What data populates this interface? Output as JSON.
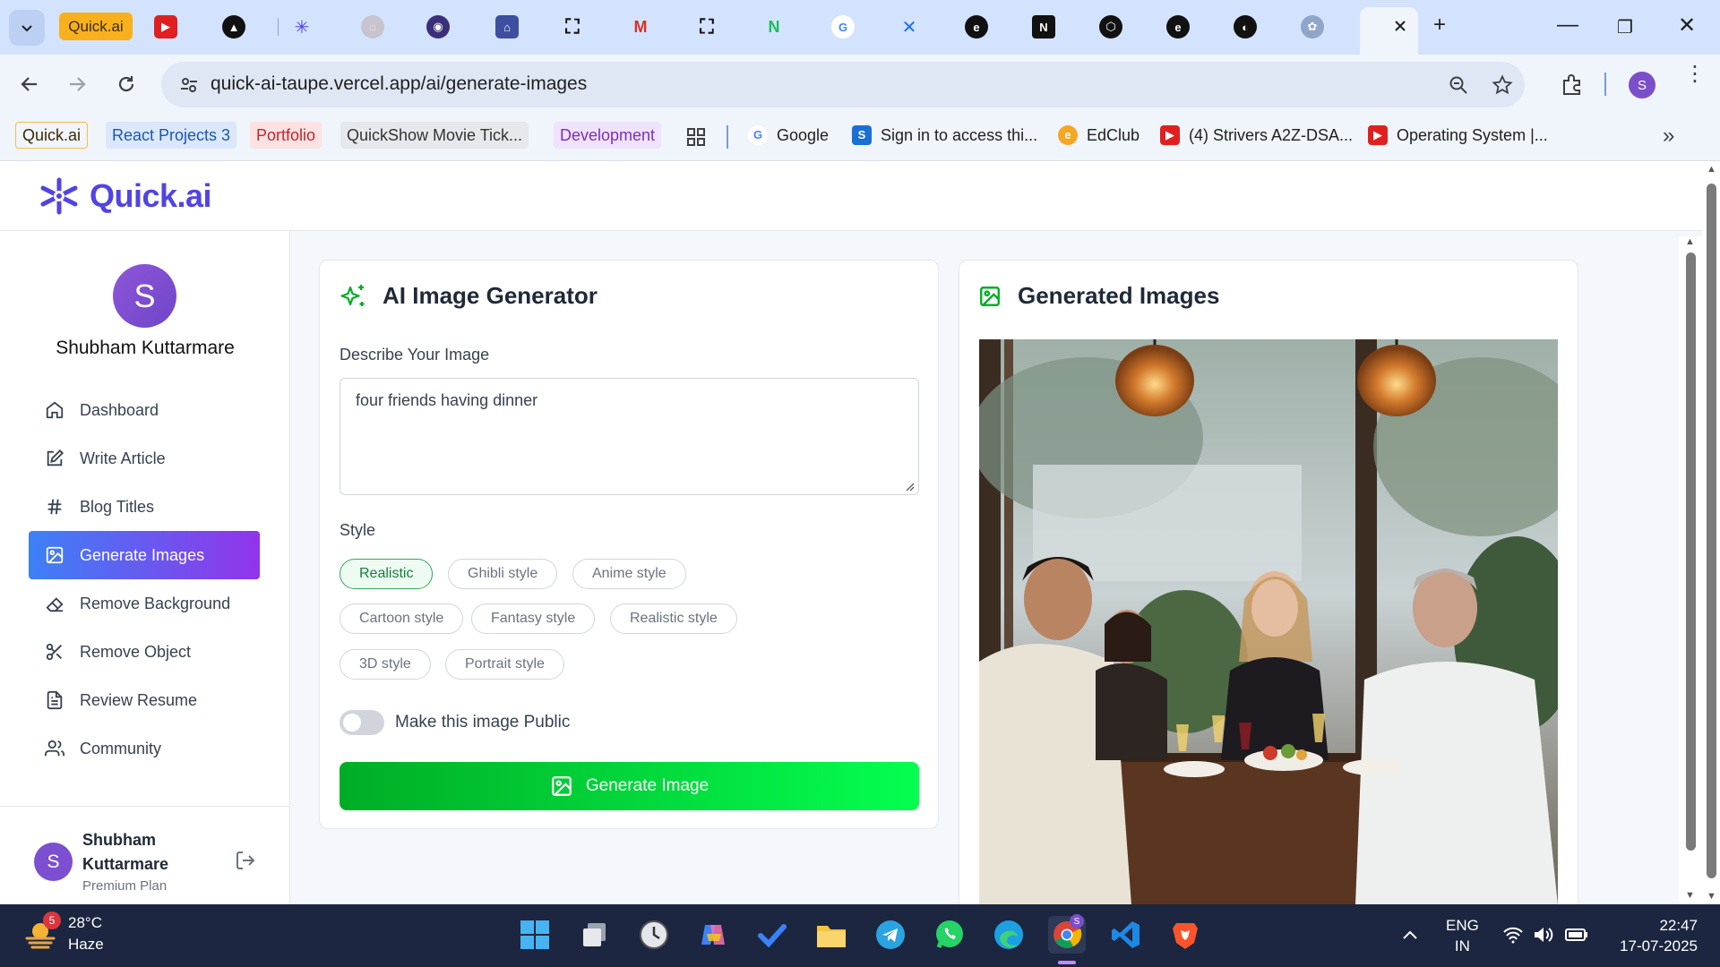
{
  "browser": {
    "first_tab_label": "Quick.ai",
    "url": "quick-ai-taupe.vercel.app/ai/generate-images"
  },
  "bookmarks": [
    {
      "label": "Quick.ai",
      "bg": "#fdf0c4",
      "color": "#3a2b00"
    },
    {
      "label": "React Projects 3",
      "bg": "#dbe8fb",
      "color": "#1a56b8"
    },
    {
      "label": "Portfolio",
      "bg": "#fde2e2",
      "color": "#c0262d"
    },
    {
      "label": "QuickShow Movie Tick...",
      "bg": "#e6e8ec",
      "color": "#333333"
    },
    {
      "label": "Development",
      "bg": "#efe3fb",
      "color": "#7b2fbe"
    }
  ],
  "bookmark_links": [
    {
      "label": "Google",
      "icon": "google-icon"
    },
    {
      "label": "Sign in to access thi...",
      "icon": "s-icon"
    },
    {
      "label": "EdClub",
      "icon": "edclub-icon"
    },
    {
      "label": "(4) Strivers A2Z-DSA...",
      "icon": "youtube-icon"
    },
    {
      "label": "Operating System |...",
      "icon": "youtube-icon"
    }
  ],
  "app": {
    "brand": "Quick.ai",
    "user_initial": "S",
    "user_name": "Shubham Kuttarmare",
    "plan": "Premium Plan"
  },
  "nav": [
    {
      "label": "Dashboard",
      "icon": "home-icon"
    },
    {
      "label": "Write Article",
      "icon": "edit-icon"
    },
    {
      "label": "Blog Titles",
      "icon": "hash-icon"
    },
    {
      "label": "Generate Images",
      "icon": "image-icon",
      "active": true
    },
    {
      "label": "Remove Background",
      "icon": "eraser-icon"
    },
    {
      "label": "Remove Object",
      "icon": "scissors-icon"
    },
    {
      "label": "Review Resume",
      "icon": "file-text-icon"
    },
    {
      "label": "Community",
      "icon": "users-icon"
    }
  ],
  "generator": {
    "title": "AI Image Generator",
    "prompt_label": "Describe Your Image",
    "prompt_value": "four friends having dinner",
    "style_label": "Style",
    "styles": [
      "Realistic",
      "Ghibli style",
      "Anime style",
      "Cartoon style",
      "Fantasy style",
      "Realistic style",
      "3D style",
      "Portrait style"
    ],
    "selected_style": "Realistic",
    "public_toggle_label": "Make this image Public",
    "public": false,
    "button_label": "Generate Image"
  },
  "result": {
    "title": "Generated Images",
    "image_alt": "four friends having dinner"
  },
  "taskbar": {
    "temperature": "28°C",
    "weather": "Haze",
    "weather_badge": "5",
    "language": "ENG",
    "region": "IN",
    "time": "22:47",
    "date": "17-07-2025"
  },
  "colors": {
    "brand": "#5044e5",
    "nav_active_from": "#3c81f6",
    "nav_active_to": "#9234ea",
    "generate_from": "#00ad25",
    "generate_to": "#04ff50",
    "accent_green": "#00ad25"
  }
}
